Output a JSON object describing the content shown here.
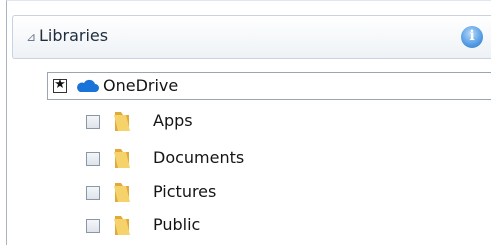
{
  "libraries": {
    "title": "Libraries",
    "collapse_glyph": "⊿",
    "info_icon": "info-icon"
  },
  "tree": {
    "root": {
      "label": "OneDrive",
      "icon": "onedrive-cloud-icon",
      "state": "starred"
    },
    "children": [
      {
        "label": "Apps",
        "icon": "folder-icon",
        "checked": false
      },
      {
        "label": "Documents",
        "icon": "folder-icon",
        "checked": false
      },
      {
        "label": "Pictures",
        "icon": "folder-icon",
        "checked": false
      },
      {
        "label": "Public",
        "icon": "folder-icon",
        "checked": false
      }
    ]
  },
  "colors": {
    "accent": "#1a73d9",
    "folder": "#f2c14a",
    "header_border": "#c9d3df"
  }
}
